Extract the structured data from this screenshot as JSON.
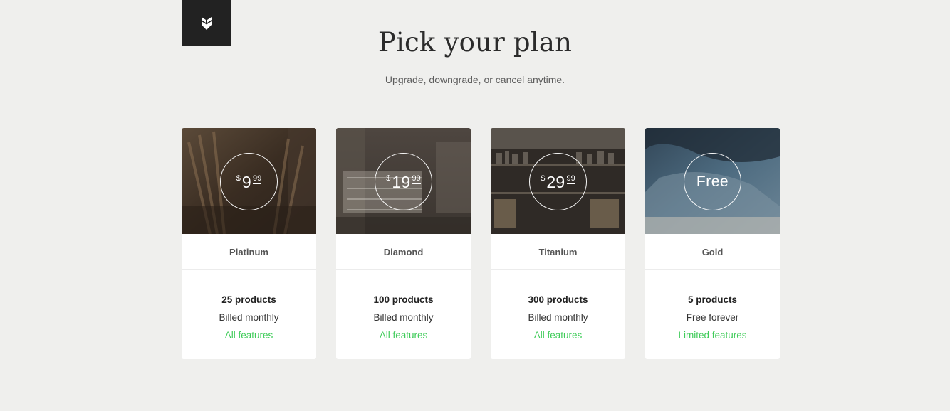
{
  "header": {
    "logo_icon": "brand-shield-icon",
    "title": "Pick your plan",
    "subtitle": "Upgrade, downgrade, or cancel anytime."
  },
  "colors": {
    "background": "#efefed",
    "logo_bg": "#222222",
    "accent_green": "#3ecb58",
    "card_bg": "#ffffff"
  },
  "plans": [
    {
      "name": "Platinum",
      "price_currency": "$",
      "price_amount": "9",
      "price_cents": "99",
      "products": "25 products",
      "billing": "Billed monthly",
      "features": "All features"
    },
    {
      "name": "Diamond",
      "price_currency": "$",
      "price_amount": "19",
      "price_cents": "99",
      "products": "100 products",
      "billing": "Billed monthly",
      "features": "All features"
    },
    {
      "name": "Titanium",
      "price_currency": "$",
      "price_amount": "29",
      "price_cents": "99",
      "products": "300 products",
      "billing": "Billed monthly",
      "features": "All features"
    },
    {
      "name": "Gold",
      "price_label": "Free",
      "products": "5 products",
      "billing": "Free forever",
      "features": "Limited features"
    }
  ]
}
